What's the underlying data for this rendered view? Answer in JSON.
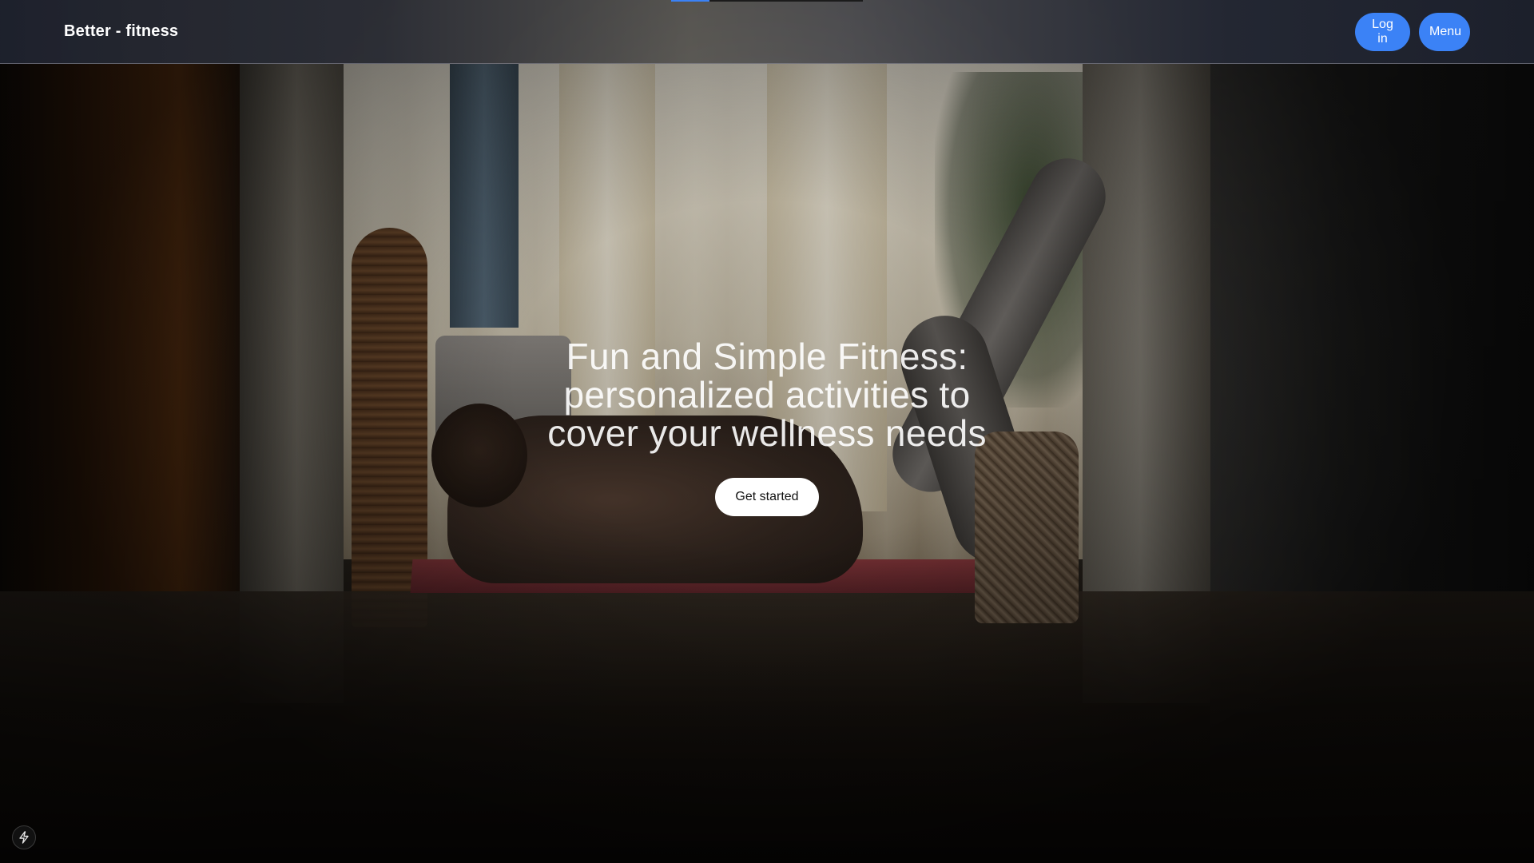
{
  "header": {
    "brand": "Better - fitness",
    "login_label": "Log in",
    "menu_label": "Menu",
    "accent_color": "#3b82f6",
    "progress_fraction": 0.2
  },
  "hero": {
    "title_lines": [
      "Fun and Simple Fitness:",
      "personalized activities to",
      "cover your wellness needs"
    ],
    "cta_label": "Get started",
    "background_description_icon": "fitness-video-background"
  },
  "footer": {
    "badge_icon": "lightning-bolt-icon"
  }
}
